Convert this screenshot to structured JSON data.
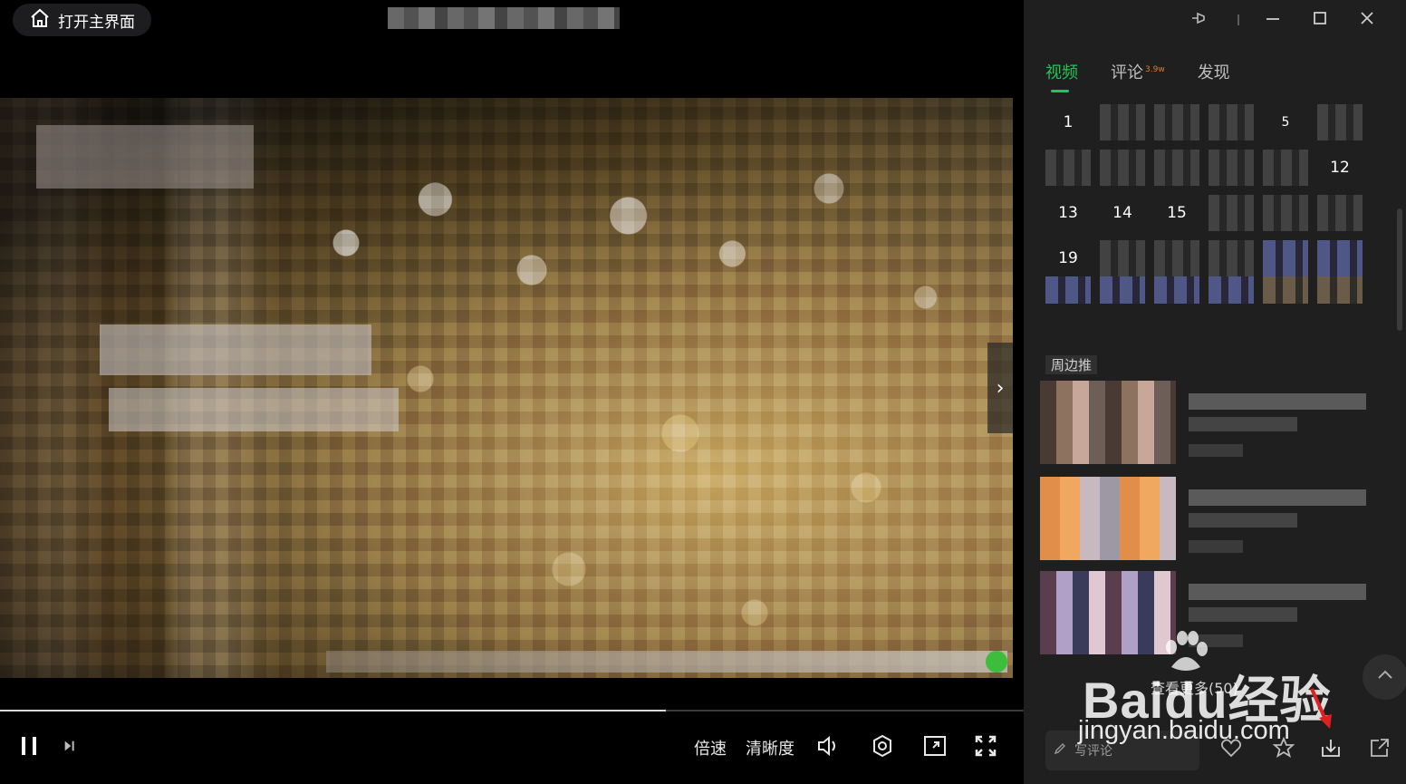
{
  "player": {
    "home_label": "打开主界面",
    "progress_fraction": 0.65,
    "speed_label": "倍速",
    "quality_label": "清晰度"
  },
  "sidebar": {
    "tabs": [
      {
        "label": "视频",
        "active": true
      },
      {
        "label": "评论",
        "badge": "3.9w",
        "active": false
      },
      {
        "label": "发现",
        "active": false
      }
    ],
    "episodes": [
      "1",
      "5",
      "12",
      "13",
      "14",
      "15",
      "19"
    ],
    "related_heading": "周边推",
    "see_more": "查看更多(50)",
    "comment_placeholder": "写评论"
  },
  "watermark": {
    "logo": "Baidu经验",
    "url": "jingyan.baidu.com"
  },
  "colors": {
    "accent": "#24c45a",
    "sidebar_bg": "#1f1f1f",
    "annotation_arrow": "#e02020"
  }
}
